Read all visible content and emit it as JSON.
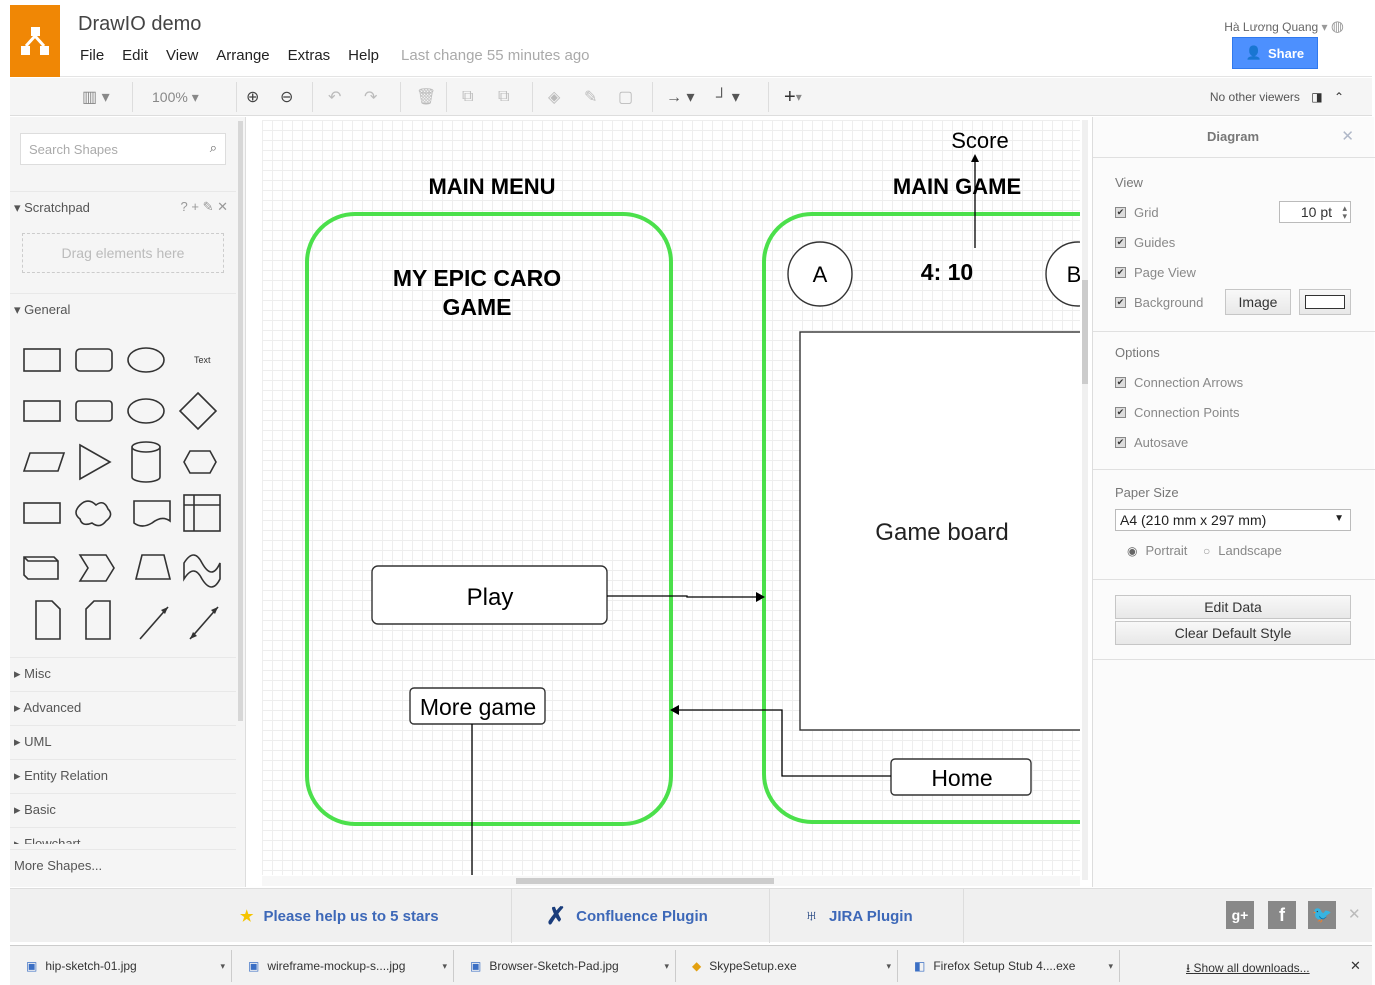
{
  "app": {
    "title": "DrawIO demo",
    "last_change": "Last change 55 minutes ago",
    "user": "Hà Lương Quang",
    "share_label": "Share"
  },
  "menu": [
    "File",
    "Edit",
    "View",
    "Arrange",
    "Extras",
    "Help"
  ],
  "toolbar": {
    "zoom": "100%",
    "viewers": "No other viewers"
  },
  "sidebar": {
    "search_placeholder": "Search Shapes",
    "scratchpad": "Scratchpad",
    "scratchpad_actions": "? + ✎ ✕",
    "drag_here": "Drag elements here",
    "general": "General",
    "text_shape": "Text",
    "sections": [
      "Misc",
      "Advanced",
      "UML",
      "Entity Relation",
      "Basic",
      "Flowchart"
    ],
    "more_shapes": "More Shapes..."
  },
  "diagram": {
    "score": "Score",
    "main_menu": "MAIN MENU",
    "main_game": "MAIN GAME",
    "game_title_1": "MY EPIC CARO",
    "game_title_2": "GAME",
    "player_a": "A",
    "player_b": "B",
    "score_value": "4: 10",
    "game_board": "Game board",
    "play": "Play",
    "more_game": "More game",
    "home": "Home"
  },
  "panel": {
    "title": "Diagram",
    "view_heading": "View",
    "grid": "Grid",
    "grid_size": "10 pt",
    "guides": "Guides",
    "page_view": "Page View",
    "background": "Background",
    "image_btn": "Image",
    "options_heading": "Options",
    "connection_arrows": "Connection Arrows",
    "connection_points": "Connection Points",
    "autosave": "Autosave",
    "paper_size_heading": "Paper Size",
    "paper_size": "A4 (210 mm x 297 mm)",
    "portrait": "Portrait",
    "landscape": "Landscape",
    "edit_data": "Edit Data",
    "clear_style": "Clear Default Style"
  },
  "footer": {
    "rate": "Please help us to 5 stars",
    "confluence": "Confluence Plugin",
    "jira": "JIRA Plugin"
  },
  "downloads": {
    "files": [
      "hip-sketch-01.jpg",
      "wireframe-mockup-s....jpg",
      "Browser-Sketch-Pad.jpg",
      "SkypeSetup.exe",
      "Firefox Setup Stub 4....exe"
    ],
    "show_all": "Show all downloads..."
  },
  "colors": {
    "brand": "#f08705",
    "accent": "#4d90fe",
    "shape_green": "#4be04b",
    "link": "#3d68b8"
  }
}
